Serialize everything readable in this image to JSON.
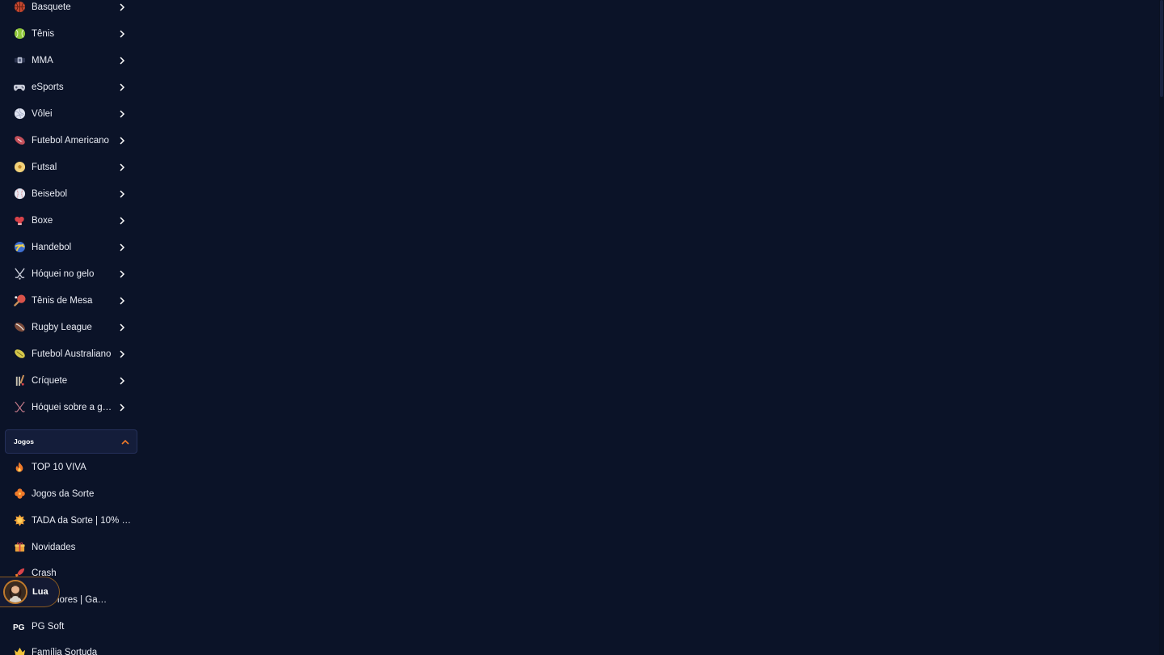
{
  "sidebar": {
    "sports": [
      {
        "label": "Basquete",
        "icon": "basketball-icon"
      },
      {
        "label": "Tênis",
        "icon": "tennis-ball-icon"
      },
      {
        "label": "MMA",
        "icon": "mma-belt-icon"
      },
      {
        "label": "eSports",
        "icon": "gamepad-icon"
      },
      {
        "label": "Vôlei",
        "icon": "volleyball-icon"
      },
      {
        "label": "Futebol Americano",
        "icon": "american-football-icon"
      },
      {
        "label": "Futsal",
        "icon": "futsal-ball-icon"
      },
      {
        "label": "Beisebol",
        "icon": "baseball-icon"
      },
      {
        "label": "Boxe",
        "icon": "boxing-glove-icon"
      },
      {
        "label": "Handebol",
        "icon": "handball-icon"
      },
      {
        "label": "Hóquei no gelo",
        "icon": "ice-hockey-sticks-icon"
      },
      {
        "label": "Tênis de Mesa",
        "icon": "ping-pong-paddle-icon"
      },
      {
        "label": "Rugby League",
        "icon": "rugby-ball-icon"
      },
      {
        "label": "Futebol Australiano",
        "icon": "aussie-rules-ball-icon"
      },
      {
        "label": "Críquete",
        "icon": "cricket-icon"
      },
      {
        "label": "Hóquei sobre a gr…",
        "icon": "field-hockey-icon"
      }
    ],
    "games_section": {
      "label": "Jogos",
      "expanded": true
    },
    "games": [
      {
        "label": "TOP 10 VIVA",
        "icon": "flame-icon"
      },
      {
        "label": "Jogos da Sorte",
        "icon": "clover-icon"
      },
      {
        "label": "TADA da Sorte | 10% de…",
        "icon": "sun-badge-icon"
      },
      {
        "label": "Novidades",
        "icon": "gift-box-icon"
      },
      {
        "label": "Crash",
        "icon": "rocket-icon"
      },
      {
        "label": "o Melhores | Ga…",
        "icon": "star-icon"
      },
      {
        "label": "PG Soft",
        "icon": "pg-soft-logo-icon"
      },
      {
        "label": "Família Sortuda",
        "icon": "crown-icon"
      }
    ]
  },
  "assistant_chip": {
    "name": "Lua",
    "icon": "avatar-icon"
  },
  "colors": {
    "background": "#0b1328",
    "section_bg": "#141d3a",
    "accent": "#f07a2a"
  }
}
